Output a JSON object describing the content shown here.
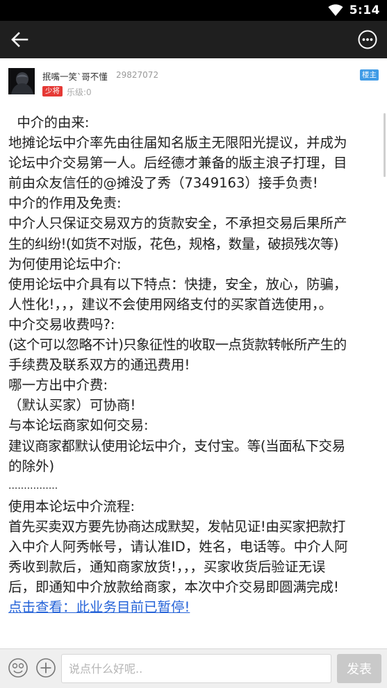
{
  "status_bar": {
    "time": "5:14",
    "wifi_icon": "wifi-icon"
  },
  "app_bar": {
    "back_icon": "arrow-left-icon",
    "more_icon": "more-horizontal-icon"
  },
  "post": {
    "author": {
      "name": "抿嘴一笑`哥不懂",
      "uid": "29827072",
      "rank": "少将",
      "level": "乐级:0",
      "op_tag": "楼主"
    },
    "lines": [
      "  中介的由来:",
      "地摊论坛中介率先由往届知名版主无限阳光提议，并成为",
      "论坛中介交易第一人。后经德才兼备的版主浪子打理，目",
      "前由众友信任的@摊没了秀（7349163）接手负责!",
      "中介的作用及免责:",
      "中介人只保证交易双方的货款安全，不承担交易后果所产",
      "生的纠纷!(如货不对版，花色，规格，数量，破损残次等)",
      "为何使用论坛中介:",
      "使用论坛中介具有以下特点：快捷，安全，放心，防骗，",
      "人性化!，，，建议不会使用网络支付的买家首选使用，。",
      "中介交易收费吗?:",
      "(这个可以忽略不计)只象征性的收取一点货款转帐所产生的",
      "手续费及联系双方的通迅费用!",
      "哪一方出中介费:",
      "（默认买家）可协商!",
      "与本论坛商家如何交易:",
      "建议商家都默认使用论坛中介，支付宝。等(当面私下交易",
      "的除外)",
      "................",
      "使用本论坛中介流程:",
      "首先买卖双方要先协商达成默契，发帖见证!由买家把款打",
      "入中介人阿秀帐号，请认准ID，姓名，电话等。中介人阿",
      "秀收到款后，通知商家放货!，，，买家收货后验证无误",
      "后，即通知中介放款给商家，本次中介交易即圆满完成!"
    ],
    "link_text": "点击查看：此业务目前已暂停!"
  },
  "bottom_bar": {
    "emoji_icon": "emoji-icon",
    "add_icon": "plus-circle-icon",
    "input_placeholder": "说点什么好呢..",
    "send_label": "发表"
  }
}
